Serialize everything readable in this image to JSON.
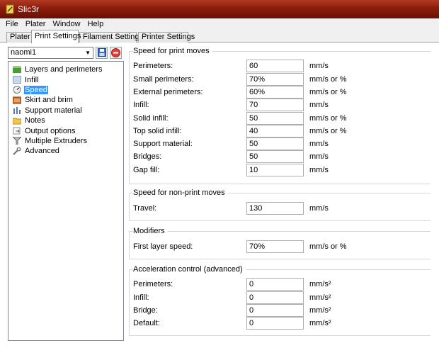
{
  "window": {
    "title": "Slic3r"
  },
  "menu": [
    "File",
    "Plater",
    "Window",
    "Help"
  ],
  "tabs": [
    "Plater",
    "Print Settings",
    "Filament Settings",
    "Printer Settings"
  ],
  "preset": {
    "value": "naomi1"
  },
  "tree": [
    {
      "label": "Layers and perimeters",
      "icon": "layers-icon"
    },
    {
      "label": "Infill",
      "icon": "infill-icon"
    },
    {
      "label": "Speed",
      "icon": "speed-icon",
      "selected": true
    },
    {
      "label": "Skirt and brim",
      "icon": "skirt-icon"
    },
    {
      "label": "Support material",
      "icon": "support-icon"
    },
    {
      "label": "Notes",
      "icon": "notes-icon"
    },
    {
      "label": "Output options",
      "icon": "output-icon"
    },
    {
      "label": "Multiple Extruders",
      "icon": "funnel-icon"
    },
    {
      "label": "Advanced",
      "icon": "wrench-icon"
    }
  ],
  "groups": {
    "print_moves": {
      "title": "Speed for print moves",
      "rows": [
        {
          "label": "Perimeters:",
          "value": "60",
          "unit": "mm/s"
        },
        {
          "label": "Small perimeters:",
          "value": "70%",
          "unit": "mm/s or %"
        },
        {
          "label": "External perimeters:",
          "value": "60%",
          "unit": "mm/s or %"
        },
        {
          "label": "Infill:",
          "value": "70",
          "unit": "mm/s"
        },
        {
          "label": "Solid infill:",
          "value": "50",
          "unit": "mm/s or %"
        },
        {
          "label": "Top solid infill:",
          "value": "40",
          "unit": "mm/s or %"
        },
        {
          "label": "Support material:",
          "value": "50",
          "unit": "mm/s"
        },
        {
          "label": "Bridges:",
          "value": "50",
          "unit": "mm/s"
        },
        {
          "label": "Gap fill:",
          "value": "10",
          "unit": "mm/s"
        }
      ]
    },
    "non_print_moves": {
      "title": "Speed for non-print moves",
      "rows": [
        {
          "label": "Travel:",
          "value": "130",
          "unit": "mm/s"
        }
      ]
    },
    "modifiers": {
      "title": "Modifiers",
      "rows": [
        {
          "label": "First layer speed:",
          "value": "70%",
          "unit": "mm/s or %"
        }
      ]
    },
    "acceleration": {
      "title": "Acceleration control (advanced)",
      "rows": [
        {
          "label": "Perimeters:",
          "value": "0",
          "unit": "mm/s²"
        },
        {
          "label": "Infill:",
          "value": "0",
          "unit": "mm/s²"
        },
        {
          "label": "Bridge:",
          "value": "0",
          "unit": "mm/s²"
        },
        {
          "label": "Default:",
          "value": "0",
          "unit": "mm/s²"
        }
      ]
    }
  }
}
